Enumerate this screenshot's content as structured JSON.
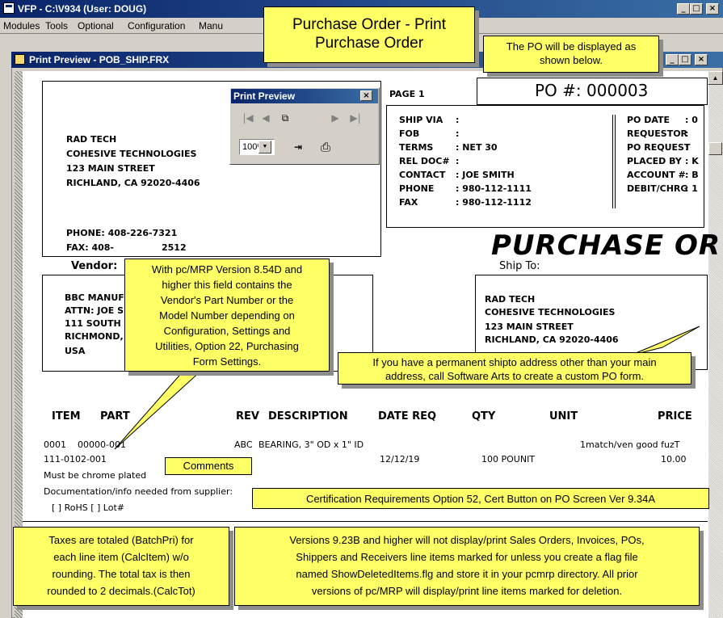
{
  "window": {
    "title": "VFP - C:\\V934 (User: DOUG)",
    "min": "_",
    "max": "□",
    "close": "×"
  },
  "menu": [
    "Modules",
    "Tools",
    "Optional",
    "Configuration",
    "Manu"
  ],
  "child": {
    "title": "Print Preview - POB_SHIP.FRX",
    "min": "_",
    "max": "□",
    "close": "×"
  },
  "toolbar": {
    "title": "Print Preview",
    "close": "×",
    "first": "|◀",
    "prev": "◀",
    "goto": "⧉",
    "next": "▶",
    "last": "▶|",
    "zoom": "100%",
    "zoom_arrow": "▼",
    "exit": "⇥",
    "print": "⎙"
  },
  "callouts": {
    "title": "Purchase Order - Print\nPurchase Order",
    "displayed": "The PO will be displayed as\nshown below.",
    "vendor_part": "With pc/MRP Version 8.54D and\nhigher this field contains the\nVendor's Part Number or the\nModel Number depending on\nConfiguration, Settings and\nUtilities, Option 22, Purchasing\nForm Settings.",
    "shipto": "If you have a permanent shipto address other than your main\naddress, call Software Arts to create a custom PO form.",
    "comments": "Comments",
    "cert": "Certification Requirements Option 52, Cert Button on PO Screen Ver 9.34A",
    "taxes": "Taxes are totaled (BatchPri) for\neach line item (CalcItem) w/o\nrounding.  The total tax is then\nrounded to 2 decimals.(CalcTot)",
    "versions": "Versions 9.23B and higher will not display/print Sales Orders, Invoices, POs,\nShippers and Receivers line items marked for unless you create a flag file\nnamed ShowDeletedItems.flg and store it in your pcmrp directory.  All prior\nversions of pc/MRP will display/print line items marked for deletion."
  },
  "report": {
    "company": [
      "RAD TECH",
      "COHESIVE TECHNOLOGIES",
      "123 MAIN STREET",
      "RICHLAND, CA 92020-4406"
    ],
    "phone": "PHONE: 408-226-7321",
    "fax": "FAX:   408-",
    "fax_tail": "2512",
    "page": "PAGE   1",
    "po_number": "PO #: 000003",
    "ship_labels": [
      "SHIP VIA",
      "FOB",
      "TERMS",
      "REL DOC#",
      "CONTACT",
      "PHONE",
      "FAX"
    ],
    "ship_values": [
      ":",
      ":",
      ": NET 30",
      ":",
      ": JOE SMITH",
      ": 980-112-1111",
      ": 980-112-1112"
    ],
    "po_labels": [
      "PO DATE",
      "REQUESTOR",
      "PO REQUEST",
      "PLACED BY",
      "ACCOUNT #",
      "DEBIT/CHRG"
    ],
    "po_values": [
      ": 0",
      ":",
      ":",
      ": K",
      ": B",
      ": 1"
    ],
    "big_title": "PURCHASE OR",
    "vendor_label": "Vendor:",
    "shipto_label": "Ship To:",
    "vendor": [
      "BBC MANUF",
      "ATTN: JOE S",
      "111 SOUTH",
      "RICHMOND,",
      "USA"
    ],
    "shipto": [
      "RAD TECH",
      "COHESIVE TECHNOLOGIES",
      "123 MAIN STREET",
      "RICHLAND, CA 92020-4406"
    ],
    "columns": [
      "ITEM",
      "PART",
      "REV",
      "DESCRIPTION",
      "DATE REQ",
      "QTY",
      "UNIT",
      "PRICE"
    ],
    "row": {
      "item": "0001",
      "part": "00000-001",
      "rev": "ABC",
      "desc": "BEARING, 3\" OD x 1\" ID",
      "unit_note": "1match/ven good fuzT",
      "part2": "111-0102-001",
      "date": "12/12/19",
      "qty": "100 POUNIT",
      "price": "10.00"
    },
    "comment1": "Must be chrome plated",
    "comment2": "Documentation/info needed from supplier:",
    "checks": "[ ] RoHS   [ ] Lot#"
  }
}
